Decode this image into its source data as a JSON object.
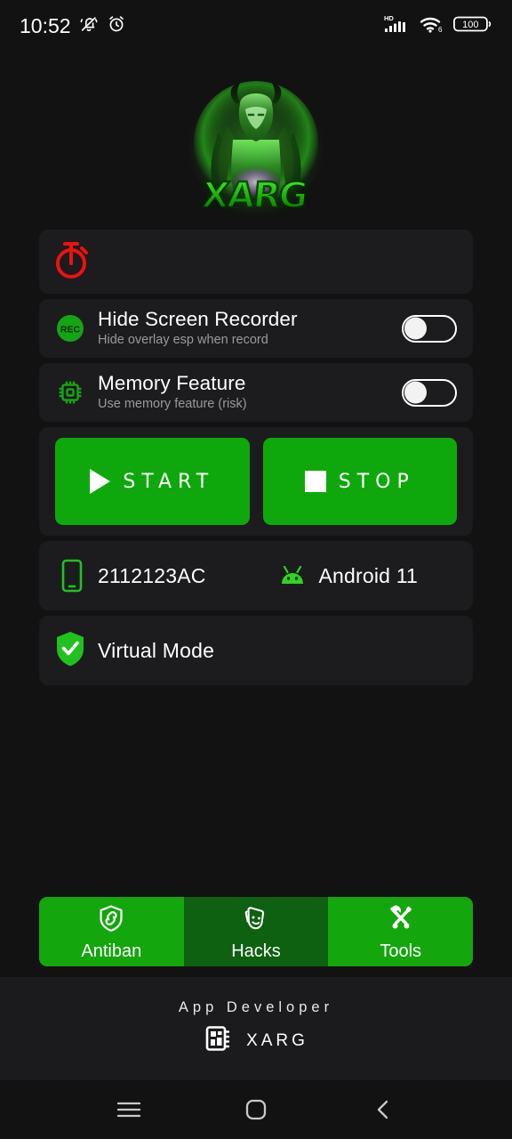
{
  "status_bar": {
    "time": "10:52",
    "icons_left": [
      "bell-mute-icon",
      "alarm-icon"
    ],
    "icons_right": [
      "hd-signal-icon",
      "wifi6-icon",
      "battery-icon"
    ],
    "battery_level": "100"
  },
  "logo": {
    "name": "xarg-logo",
    "wordmark": "XARG",
    "glow_color": "#3ce628"
  },
  "timer_card": {
    "icon": "stopwatch-icon",
    "icon_color": "#ee1111",
    "label": ""
  },
  "toggles": [
    {
      "icon": "rec-icon",
      "icon_color": "#13a813",
      "title": "Hide Screen Recorder",
      "subtitle": "Hide overlay esp when record",
      "state": "off"
    },
    {
      "icon": "memory-chip-icon",
      "icon_color": "#13a813",
      "title": "Memory Feature",
      "subtitle": "Use memory feature (risk)",
      "state": "off"
    }
  ],
  "actions": {
    "start": {
      "label": "START",
      "icon": "play-icon",
      "color": "#0fa80c"
    },
    "stop": {
      "label": "STOP",
      "icon": "stop-square-icon",
      "color": "#0fa80c"
    }
  },
  "device": {
    "model": "2112123AC",
    "model_icon": "phone-icon",
    "os": "Android 11",
    "os_icon": "android-robot-icon",
    "virtual_mode": "Virtual Mode",
    "virtual_icon": "shield-check-icon",
    "accent": "#21c11f"
  },
  "tabs": [
    {
      "label": "Antiban",
      "icon": "shield-link-icon",
      "color": "#13a60d",
      "selected": false
    },
    {
      "label": "Hacks",
      "icon": "theater-mask-icon",
      "color": "#0d6110",
      "selected": true
    },
    {
      "label": "Tools",
      "icon": "tools-icon",
      "color": "#13a60d",
      "selected": false
    }
  ],
  "footer": {
    "title": "App Developer",
    "icon": "chip-board-icon",
    "name": "XARG"
  },
  "navbar": {
    "recents": "menu-icon",
    "home": "home-square-icon",
    "back": "chevron-left-icon"
  }
}
